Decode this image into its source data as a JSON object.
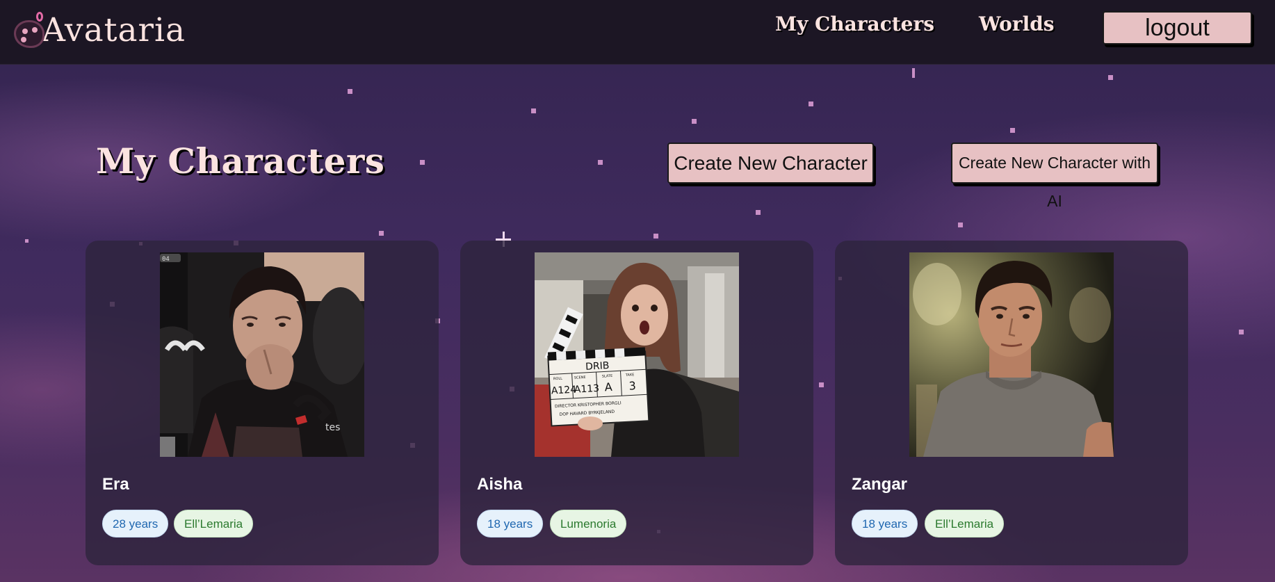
{
  "app": {
    "logo_text": "Avataria"
  },
  "nav": {
    "my_characters": "My Characters",
    "worlds": "Worlds",
    "logout": "logout"
  },
  "main": {
    "title": "My Characters",
    "create_button": "Create New Character",
    "create_ai_button": "Create New Character  with AI"
  },
  "characters": [
    {
      "name": "Era",
      "age": "28 years",
      "world": "Ell’Lemaria"
    },
    {
      "name": "Aisha",
      "age": "18 years",
      "world": "Lumenoria"
    },
    {
      "name": "Zangar",
      "age": "18 years",
      "world": "Ell’Lemaria"
    }
  ],
  "photo_labels": {
    "clapper_title": "DRIB",
    "clapper_heads": [
      "ROLL",
      "SCENE",
      "SLATE",
      "TAKE"
    ],
    "clapper_values": [
      "A124",
      "A113",
      "A",
      "3"
    ],
    "clapper_director": "DIRECTOR KRISTOPHER BORGLI",
    "clapper_dop": "DOP HAVARD BYRKJELAND",
    "monitor_label": "04",
    "shirt_text": "tes"
  },
  "colors": {
    "header_bg": "#1c1624",
    "button_bg": "#e7c1c3",
    "title_text": "#fbe3e0",
    "age_tag_bg": "#e6f1fb",
    "age_tag_text": "#1f67b0",
    "world_tag_bg": "#e7f5e4",
    "world_tag_text": "#2b7a2e"
  }
}
